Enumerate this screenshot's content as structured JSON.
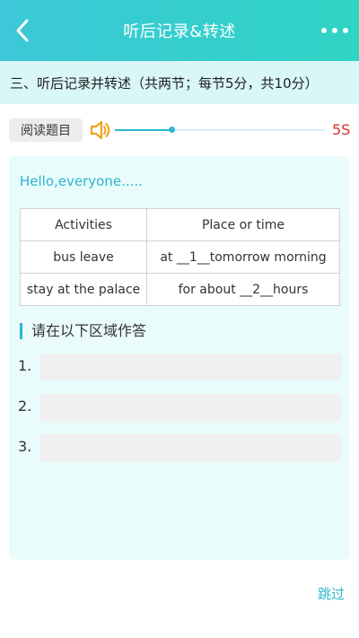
{
  "header": {
    "title": "听后记录&转述",
    "back_icon": "chevron-left-icon",
    "more_icon": "more-dots-icon",
    "gradient_start": "#3cc8d8",
    "gradient_end": "#2fd4c4"
  },
  "section": {
    "heading": "三、听后记录并转述（共两节；每节5分，共10分）"
  },
  "audio": {
    "read_button_label": "阅读题目",
    "speaker_icon": "speaker-icon",
    "progress_fraction": 0.27,
    "timer": "5S",
    "accent": "#2bb7cf",
    "timer_color": "#d9312b"
  },
  "passage": {
    "greeting": "Hello,everyone.....",
    "table": {
      "headers": [
        "Activities",
        "Place or time"
      ],
      "rows": [
        [
          "bus leave",
          "at __1__tomorrow morning"
        ],
        [
          "stay at the palace",
          "for about __2__hours"
        ]
      ]
    }
  },
  "answer_area": {
    "heading": "请在以下区域作答",
    "items": [
      {
        "number": "1.",
        "value": ""
      },
      {
        "number": "2.",
        "value": ""
      },
      {
        "number": "3.",
        "value": ""
      }
    ]
  },
  "footer": {
    "skip_label": "跳过"
  }
}
